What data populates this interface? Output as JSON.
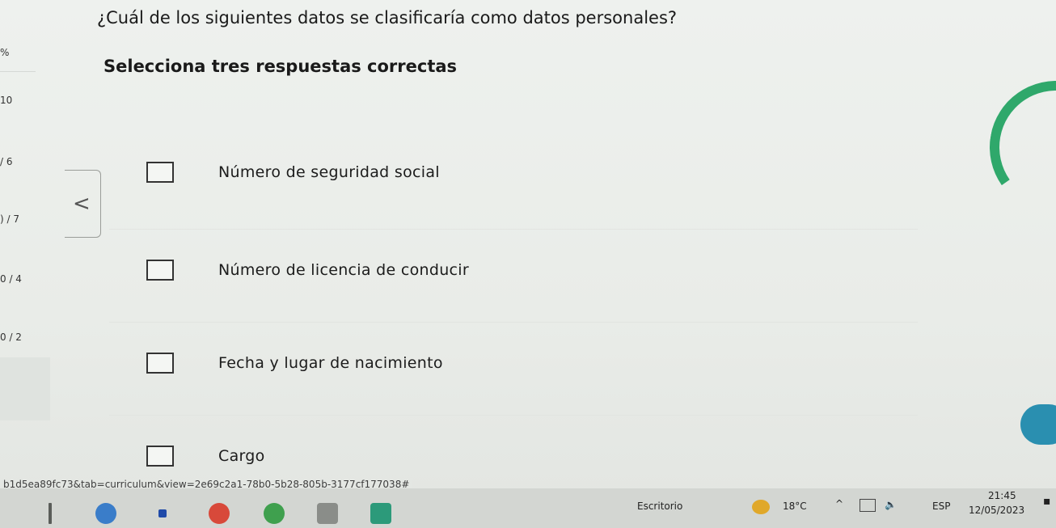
{
  "sidebar": {
    "items": [
      {
        "label": "%"
      },
      {
        "label": "10"
      },
      {
        "label": "/ 6"
      },
      {
        "label": ") / 7"
      },
      {
        "label": "0 / 4"
      },
      {
        "label": "0 / 2"
      }
    ]
  },
  "question": {
    "title": "¿Cuál de los siguientes datos se clasificaría como datos personales?",
    "instruction": "Selecciona tres respuestas correctas"
  },
  "nav": {
    "back_symbol": "<"
  },
  "options": [
    {
      "label": "Número de seguridad social",
      "checked": false
    },
    {
      "label": "Número de licencia de conducir",
      "checked": false
    },
    {
      "label": "Fecha y lugar de nacimiento",
      "checked": false
    },
    {
      "label": "Cargo",
      "checked": false
    }
  ],
  "status_url": "b1d5ea89fc73&tab=curriculum&view=2e69c2a1-78b0-5b28-805b-3177cf177038#",
  "taskbar": {
    "desktop_label": "Escritorio",
    "temperature": "18°C",
    "language": "ESP",
    "time": "21:45",
    "date": "12/05/2023"
  },
  "colors": {
    "spinner": "#2fa86b",
    "help_button": "#2a8fb0"
  }
}
